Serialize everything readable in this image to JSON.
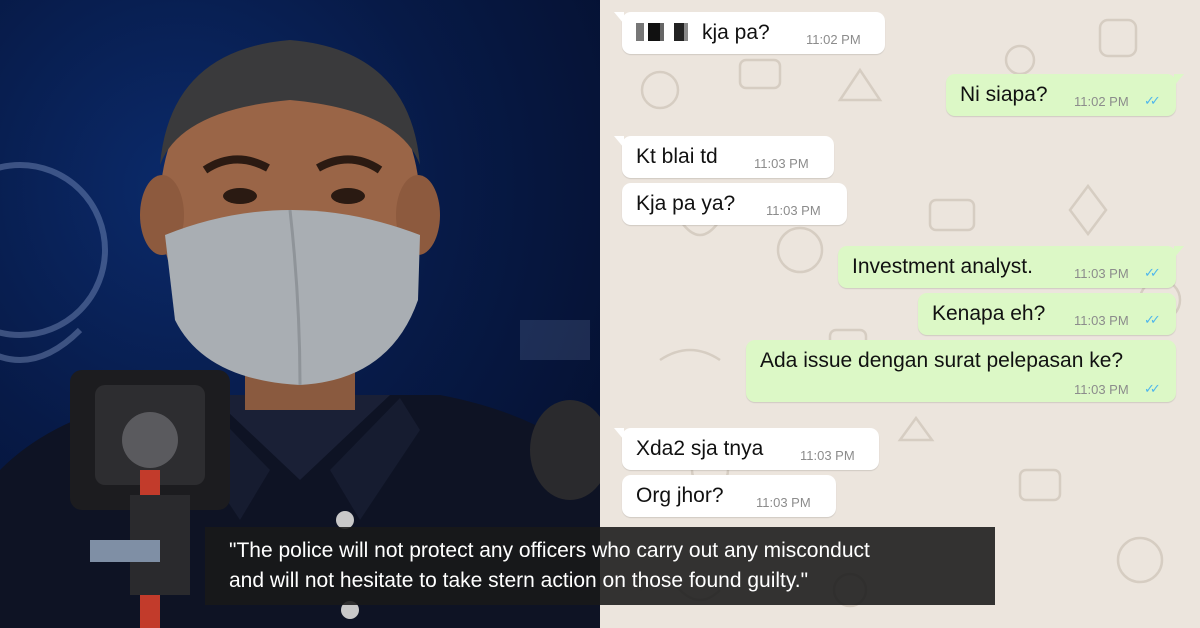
{
  "messages": [
    {
      "text": "kja pa?",
      "time": "11:02 PM",
      "dir": "in",
      "redacted_prefix": true
    },
    {
      "text": "Ni siapa?",
      "time": "11:02 PM",
      "dir": "out",
      "status": "read"
    },
    {
      "text": "Kt blai td",
      "time": "11:03 PM",
      "dir": "in"
    },
    {
      "text": "Kja pa ya?",
      "time": "11:03 PM",
      "dir": "in"
    },
    {
      "text": "Investment analyst.",
      "time": "11:03 PM",
      "dir": "out",
      "status": "read"
    },
    {
      "text": "Kenapa eh?",
      "time": "11:03 PM",
      "dir": "out",
      "status": "read"
    },
    {
      "text": "Ada issue dengan surat pelepasan ke?",
      "time": "11:03 PM",
      "dir": "out",
      "status": "read"
    },
    {
      "text": "Xda2 sja tnya",
      "time": "11:03 PM",
      "dir": "in"
    },
    {
      "text": "Org jhor?",
      "time": "11:03 PM",
      "dir": "in"
    }
  ],
  "quote": {
    "line1": "\"The police will not protect any officers who carry out any misconduct",
    "line2": "and will not hesitate to take stern action on those found guilty.\""
  },
  "colors": {
    "incoming": "#ffffff",
    "outgoing": "#dcf8c6",
    "read_ticks": "#4fb6ec",
    "chat_bg": "#ece5dd"
  },
  "icons": {
    "read_receipt": "double-check-icon"
  }
}
